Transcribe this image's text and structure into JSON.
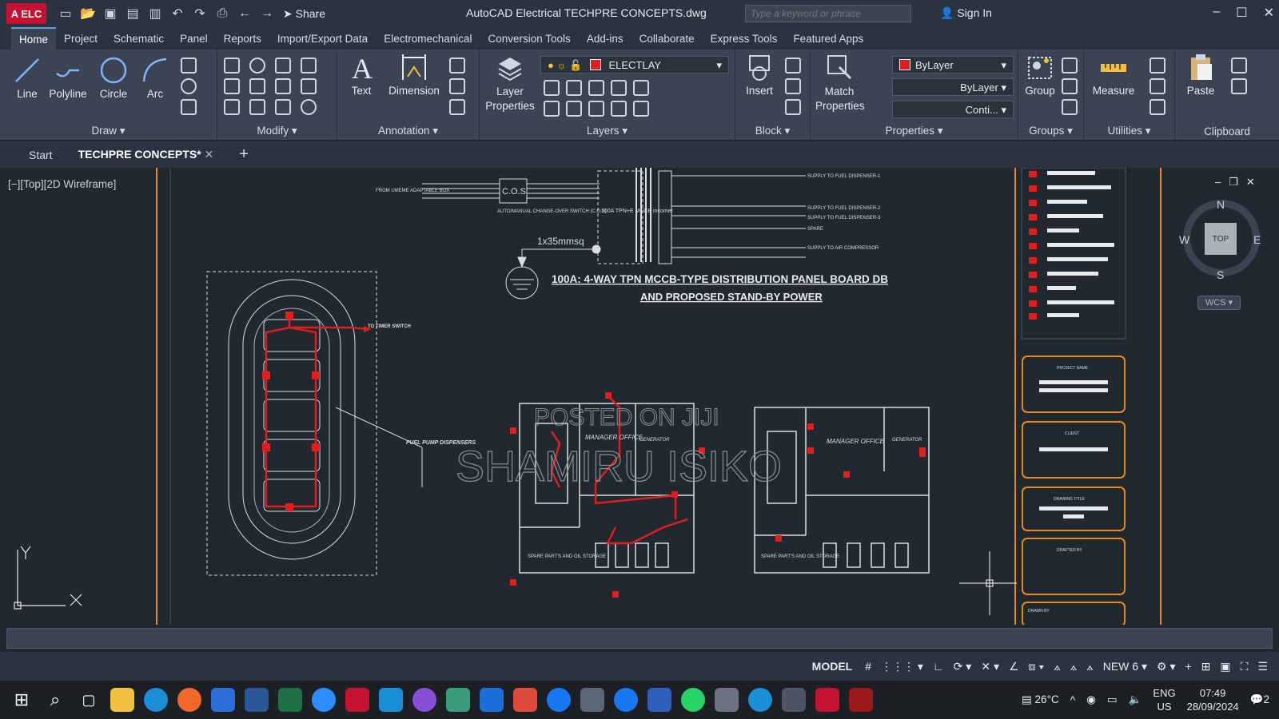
{
  "window": {
    "logo_text": "A ELC",
    "share_label": "Share",
    "title": "AutoCAD Electrical   TECHPRE CONCEPTS.dwg",
    "search_placeholder": "Type a keyword or phrase",
    "signin_label": "Sign In",
    "controls": [
      "–",
      "☐",
      "✕"
    ]
  },
  "ribbon_tabs": [
    "Home",
    "Project",
    "Schematic",
    "Panel",
    "Reports",
    "Import/Export Data",
    "Electromechanical",
    "Conversion Tools",
    "Add-ins",
    "Collaborate",
    "Express Tools",
    "Featured Apps"
  ],
  "ribbon": {
    "draw": {
      "title": "Draw",
      "line": "Line",
      "polyline": "Polyline",
      "circle": "Circle",
      "arc": "Arc"
    },
    "modify": {
      "title": "Modify"
    },
    "annotation": {
      "title": "Annotation",
      "text": "Text",
      "dimension": "Dimension"
    },
    "layers": {
      "title": "Layers",
      "layer_properties": "Layer Properties",
      "current_layer": "ELECTLAY"
    },
    "block": {
      "title": "Block",
      "insert": "Insert"
    },
    "properties": {
      "title": "Properties",
      "match": "Match Properties",
      "color": "ByLayer",
      "lineweight": "ByLayer",
      "linetype": "Conti..."
    },
    "groups": {
      "title": "Groups",
      "group": "Group"
    },
    "utilities": {
      "title": "Utilities",
      "measure": "Measure"
    },
    "clipboard": {
      "title": "Clipboard",
      "paste": "Paste"
    }
  },
  "doc_tabs": {
    "start": "Start",
    "active": "TECHPRE CONCEPTS*",
    "add": "+"
  },
  "viewport": {
    "label": "[−][Top][2D Wireframe]",
    "compass": {
      "n": "N",
      "s": "S",
      "e": "E",
      "w": "W",
      "top": "TOP",
      "wcs": "WCS"
    },
    "ucs": {
      "x": "X",
      "y": "Y"
    }
  },
  "drawing": {
    "panel_title_1": "100A: 4-WAY TPN MCCB-TYPE DISTRIBUTION PANEL BOARD DB",
    "panel_title_2": "AND PROPOSED STAND-BY POWER",
    "cos": "C.O.S",
    "earth_label": "1x35mmsq",
    "mccb_label": "100A TPN+E MCCB incomer",
    "from_label": "FROM UMEME ADAPTABLE BOX",
    "cos_label": "AUTO/MANUAL CHANGE-OVER SWITCH (C.O.S)",
    "timer": "TO TIMER SWITCH",
    "fuel": "FUEL PUMP DISPENSERS",
    "manager_office": "MANAGER OFFICE",
    "generator": "GENERATOR",
    "spare_parts": "SPARE PART'S AND OIL STORAGE",
    "watermark_1": "POSTED ON JIJI",
    "watermark_2": "SHAMIRU ISIKO",
    "supply_lines": [
      "SUPPLY TO FUEL DISPENSER-1",
      "SUPPLY TO FUEL DISPENSER-2",
      "SUPPLY TO FUEL DISPENSER-3",
      "SPARE",
      "SUPPLY TO AIR COMPRESSOR"
    ],
    "title_block": [
      "PROJECT NAME",
      "CLIENT",
      "DRAWING TITLE",
      "DRAFTED BY",
      "DRAWN BY"
    ]
  },
  "status": {
    "model": "MODEL",
    "annoscale": "NEW 6"
  },
  "taskbar": {
    "temp": "26°C",
    "lang1": "ENG",
    "lang2": "US",
    "time": "07:49",
    "date": "28/09/2024",
    "notif": "2"
  },
  "colors": {
    "red": "#e21d1d",
    "orange": "#e8891e",
    "line": "#d8dde3",
    "bg": "#212830"
  }
}
